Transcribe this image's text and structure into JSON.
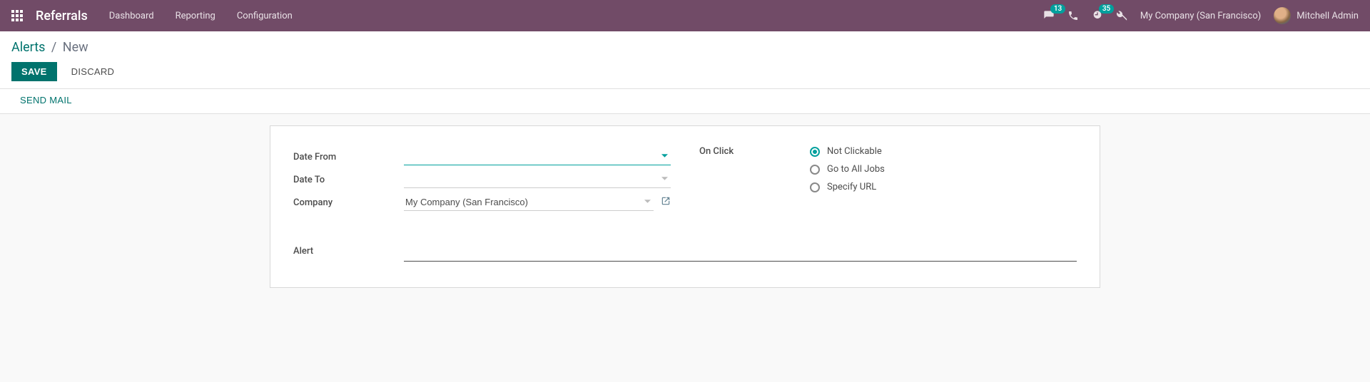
{
  "navbar": {
    "brand": "Referrals",
    "menu": [
      "Dashboard",
      "Reporting",
      "Configuration"
    ],
    "messages_badge": "13",
    "activities_badge": "35",
    "company": "My Company (San Francisco)",
    "user": "Mitchell Admin"
  },
  "breadcrumb": {
    "parent": "Alerts",
    "current": "New"
  },
  "actions": {
    "save": "SAVE",
    "discard": "DISCARD"
  },
  "status": {
    "send_mail": "SEND MAIL"
  },
  "form": {
    "labels": {
      "date_from": "Date From",
      "date_to": "Date To",
      "company": "Company",
      "on_click": "On Click",
      "alert": "Alert"
    },
    "values": {
      "date_from": "",
      "date_to": "",
      "company": "My Company (San Francisco)",
      "alert": ""
    },
    "on_click_options": [
      {
        "label": "Not Clickable",
        "checked": true
      },
      {
        "label": "Go to All Jobs",
        "checked": false
      },
      {
        "label": "Specify URL",
        "checked": false
      }
    ]
  }
}
